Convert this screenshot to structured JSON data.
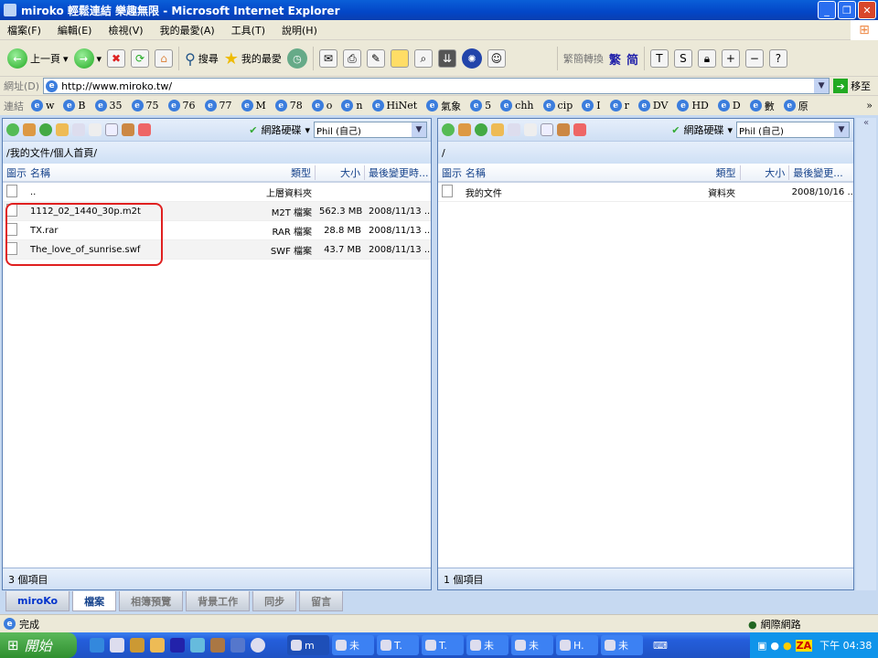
{
  "window": {
    "title": "miroko 輕鬆連結 樂趣無限 - Microsoft Internet Explorer",
    "min": "_",
    "max": "❐",
    "close": "✕"
  },
  "menu": [
    "檔案(F)",
    "編輯(E)",
    "檢視(V)",
    "我的最愛(A)",
    "工具(T)",
    "說明(H)"
  ],
  "toolbar": {
    "back": "上一頁",
    "search": "搜尋",
    "favorites": "我的最愛",
    "convert_label": "繁簡轉換",
    "trad": "繁",
    "simp": "简"
  },
  "address": {
    "label": "網址(D)",
    "url": "http://www.miroko.tw/",
    "go": "移至"
  },
  "links": {
    "label": "連結",
    "items": [
      "w",
      "B",
      "35",
      "75",
      "76",
      "77",
      "M",
      "78",
      "o",
      "n",
      "HiNet",
      "氣象",
      "5",
      "chh",
      "cip",
      "I",
      "r",
      "DV",
      "HD",
      "D",
      "數",
      "原"
    ],
    "more": "»"
  },
  "left_panel": {
    "drive": "網路硬碟",
    "user": "Phil (自己)",
    "path": "/我的文件/個人首頁/",
    "columns": [
      "圖示",
      "名稱",
      "類型",
      "大小",
      "最後變更時..."
    ],
    "rows": [
      {
        "name": "..",
        "type": "上層資料夾",
        "size": "",
        "date": ""
      },
      {
        "name": "1112_02_1440_30p.m2t",
        "type": "M2T 檔案",
        "size": "562.3 MB",
        "date": "2008/11/13 ..."
      },
      {
        "name": "TX.rar",
        "type": "RAR 檔案",
        "size": "28.8 MB",
        "date": "2008/11/13 ..."
      },
      {
        "name": "The_love_of_sunrise.swf",
        "type": "SWF 檔案",
        "size": "43.7 MB",
        "date": "2008/11/13 ..."
      }
    ],
    "count": "3 個項目"
  },
  "right_panel": {
    "drive": "網路硬碟",
    "user": "Phil (自己)",
    "path": "/",
    "columns": [
      "圖示",
      "名稱",
      "類型",
      "大小",
      "最後變更..."
    ],
    "rows": [
      {
        "name": "我的文件",
        "type": "資料夾",
        "size": "",
        "date": "2008/10/16 ..."
      }
    ],
    "count": "1 個項目"
  },
  "collapse": "«",
  "tabs": [
    "miroKo",
    "檔案",
    "相簿預覽",
    "背景工作",
    "同步",
    "留言"
  ],
  "status": {
    "text": "完成",
    "zone": "網際網路"
  },
  "taskbar": {
    "start": "開始",
    "tasks": [
      "m",
      "未",
      "T.",
      "T.",
      "未",
      "未",
      "H.",
      "未"
    ],
    "clock": "下午 04:38",
    "za": "ZA"
  }
}
